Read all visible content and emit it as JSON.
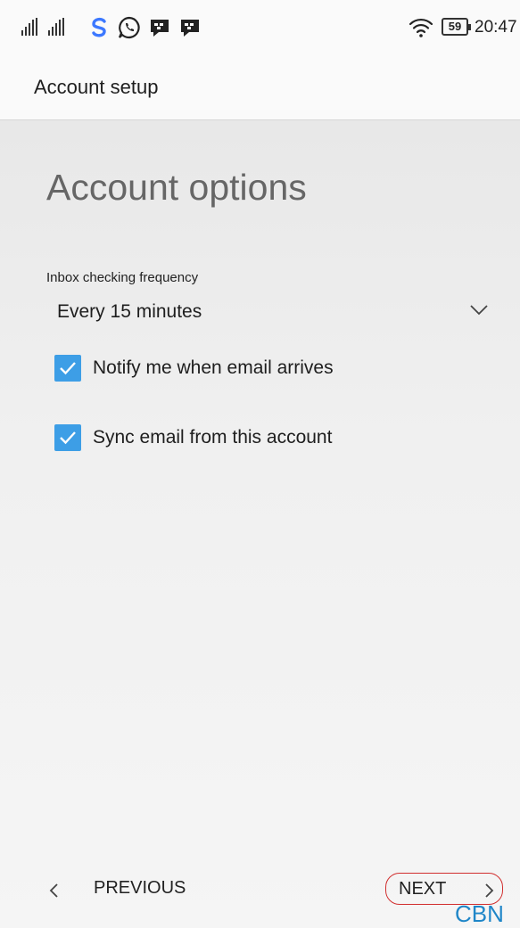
{
  "status_bar": {
    "battery_level": "59",
    "time": "20:47",
    "icons": [
      "signal-icon",
      "skype-icon",
      "whatsapp-icon",
      "bbm-icon",
      "bbm-icon",
      "wifi-icon",
      "battery-icon"
    ]
  },
  "app_bar": {
    "title": "Account setup"
  },
  "main": {
    "heading": "Account options",
    "frequency": {
      "label": "Inbox checking frequency",
      "selected": "Every 15 minutes"
    },
    "checkboxes": [
      {
        "label": "Notify me when email arrives",
        "checked": true
      },
      {
        "label": "Sync email from this account",
        "checked": true
      }
    ]
  },
  "footer": {
    "previous_label": "PREVIOUS",
    "next_label": "NEXT"
  },
  "watermark": "CBN",
  "colors": {
    "accent": "#3d9ee6",
    "next_outline": "#d12e2e",
    "watermark": "#1f86c8"
  }
}
